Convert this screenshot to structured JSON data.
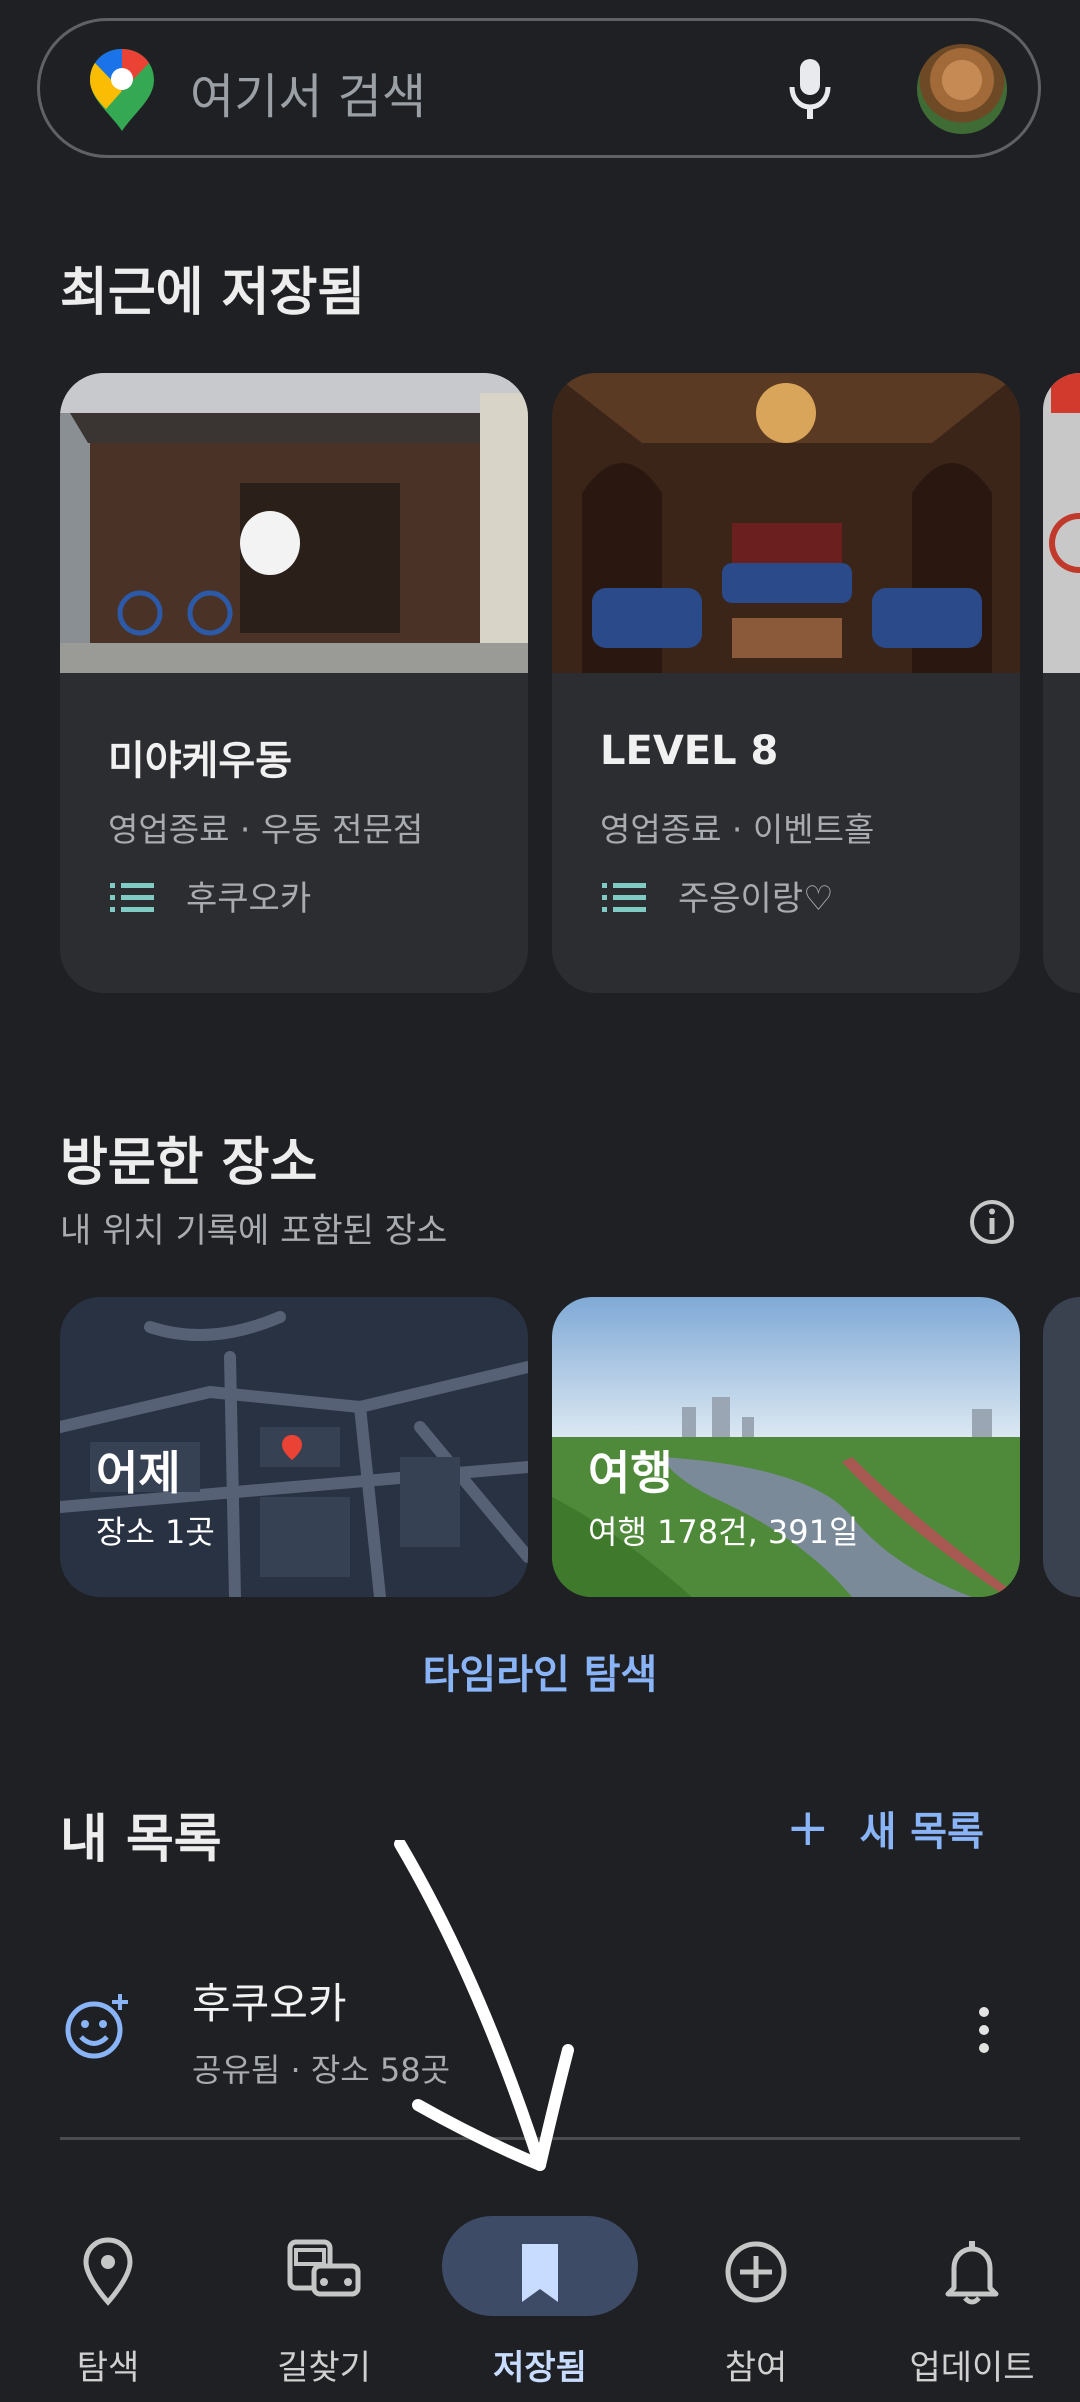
{
  "search": {
    "placeholder": "여기서 검색"
  },
  "recent": {
    "title": "최근에 저장됨",
    "cards": [
      {
        "name": "미야케우동",
        "status": "영업종료 · 우동 전문점",
        "list": "후쿠오카"
      },
      {
        "name": "LEVEL 8",
        "status": "영업종료 · 이벤트홀",
        "list": "주응이랑♡"
      }
    ]
  },
  "visited": {
    "title": "방문한 장소",
    "subtitle": "내 위치 기록에 포함된 장소",
    "cards": [
      {
        "title": "어제",
        "sub": "장소 1곳"
      },
      {
        "title": "여행",
        "sub": "여행 178건, 391일"
      }
    ],
    "timeline_link": "타임라인 탐색"
  },
  "mylists": {
    "title": "내 목록",
    "new_list": "새 목록",
    "items": [
      {
        "name": "후쿠오카",
        "meta": "공유됨 · 장소 58곳"
      }
    ]
  },
  "nav": {
    "items": [
      {
        "label": "탐색",
        "icon": "pin-icon"
      },
      {
        "label": "길찾기",
        "icon": "commute-icon"
      },
      {
        "label": "저장됨",
        "icon": "bookmark-icon",
        "selected": true
      },
      {
        "label": "참여",
        "icon": "add-circle-icon"
      },
      {
        "label": "업데이트",
        "icon": "bell-icon"
      }
    ]
  },
  "colors": {
    "background": "#1f2023",
    "accent": "#8ab4f8",
    "nav_pill": "#3e4b66",
    "list_icon": "#80cbc4"
  }
}
